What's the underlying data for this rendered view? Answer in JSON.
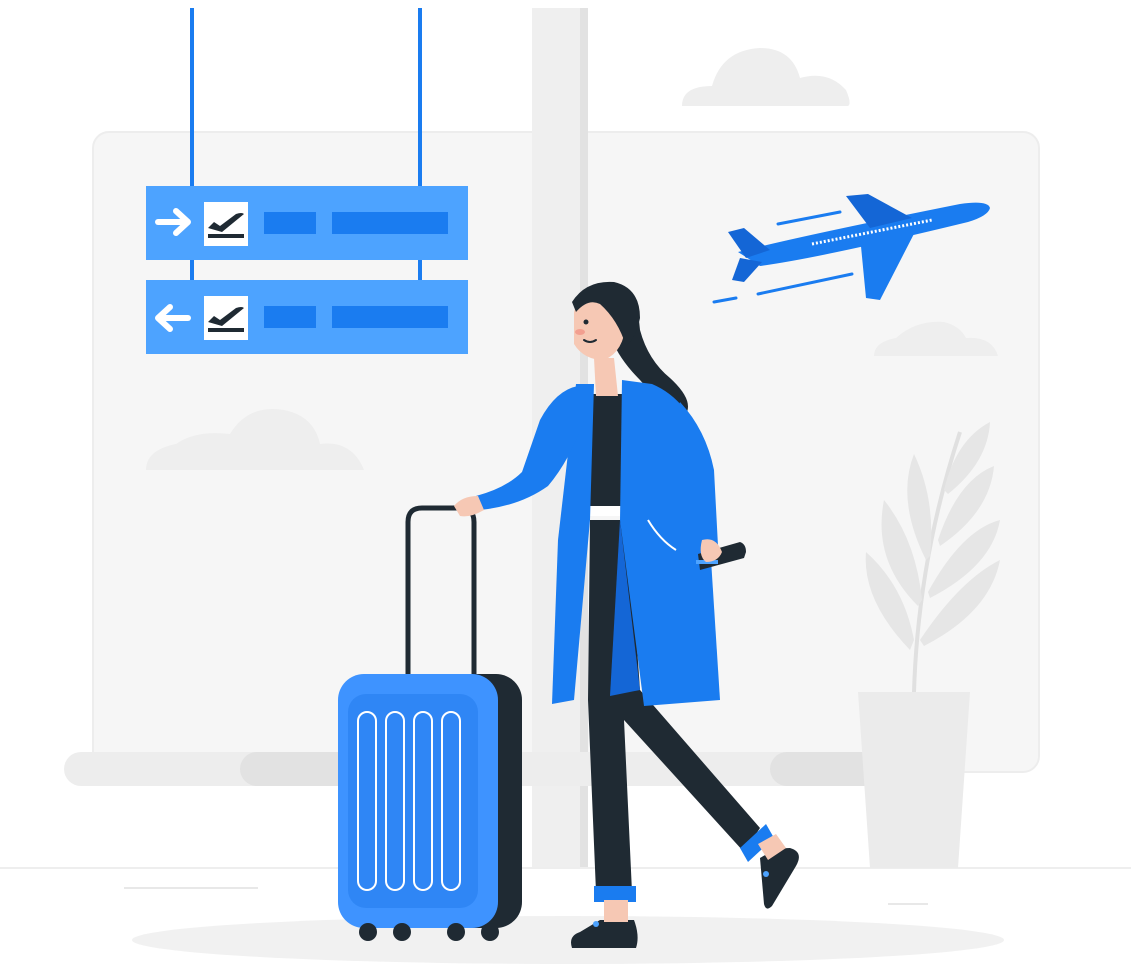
{
  "illustration": {
    "subject": "traveler-at-airport",
    "colors": {
      "accent": "#1A7CF0",
      "accent_light": "#4DA3FF",
      "accent_dark": "#1466D6",
      "dark": "#1F2A33",
      "skin": "#F6C8B4",
      "background_gray": "#F1F1F1",
      "background_gray_dark": "#E4E4E4",
      "white": "#FFFFFF"
    },
    "signs": [
      {
        "direction": "right",
        "icon": "departure-icon"
      },
      {
        "direction": "left",
        "icon": "departure-icon"
      }
    ],
    "icons": [
      "arrow-right-icon",
      "arrow-left-icon",
      "departure-icon",
      "airplane-icon",
      "plant-icon",
      "cloud-icon",
      "suitcase-icon",
      "phone-icon"
    ]
  }
}
